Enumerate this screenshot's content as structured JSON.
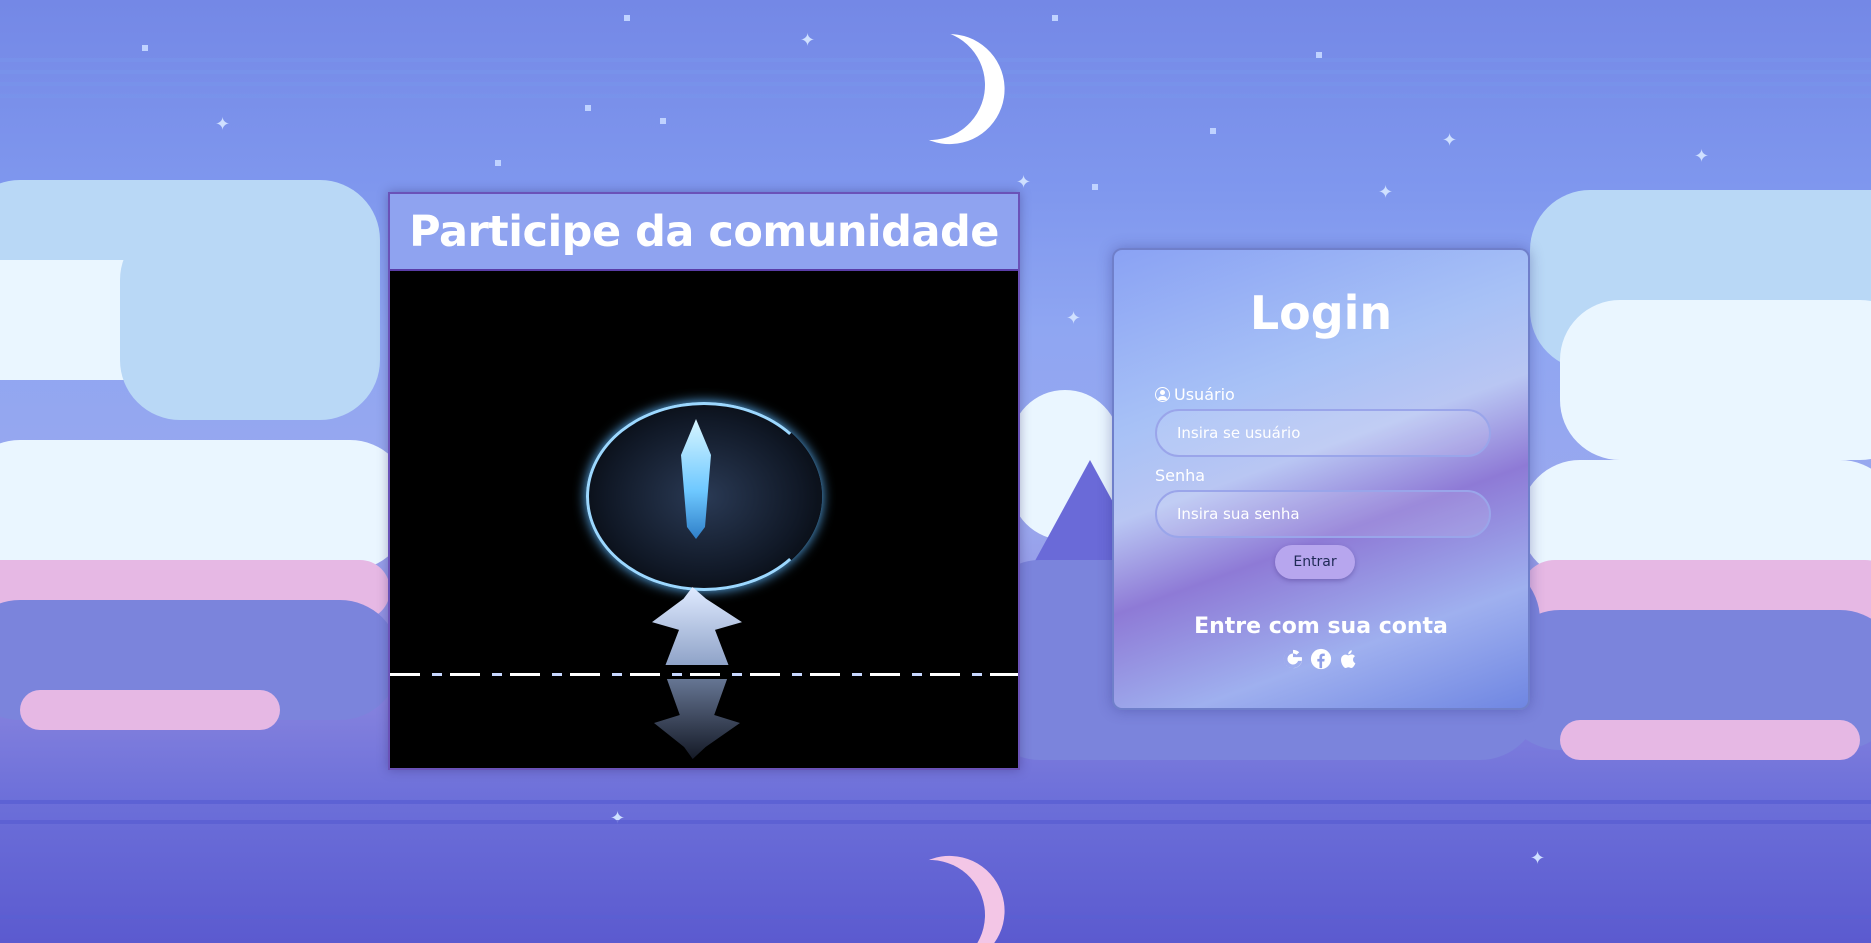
{
  "community": {
    "title": "Participe da comunidade"
  },
  "login": {
    "title": "Login",
    "username": {
      "label": "Usuário",
      "placeholder": "Insira se usuário",
      "value": ""
    },
    "password": {
      "label": "Senha",
      "placeholder": "Insira sua senha",
      "value": ""
    },
    "submit_label": "Entrar",
    "social_title": "Entre com sua conta",
    "social_icons": [
      "google-icon",
      "facebook-icon",
      "apple-icon"
    ]
  },
  "colors": {
    "panel_border": "#6f7fca",
    "button_bg": "#b7a6ee",
    "title_bar_bg": "#8fa3f0"
  }
}
